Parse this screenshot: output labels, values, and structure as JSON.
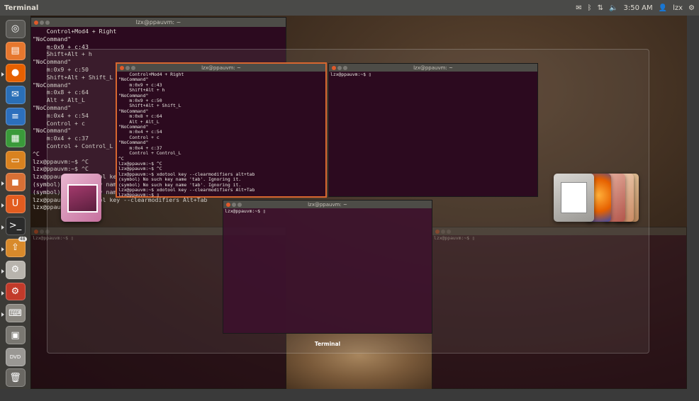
{
  "panel": {
    "app_title": "Terminal",
    "time": "3:50 AM",
    "user": "lzx",
    "icons": [
      "mail-icon",
      "bluetooth-icon",
      "network-icon",
      "volume-icon",
      "user-icon",
      "gear-icon"
    ]
  },
  "launcher": {
    "items": [
      {
        "name": "dash-home",
        "glyph": "◎",
        "color": "#5a5955"
      },
      {
        "name": "files",
        "glyph": "▤",
        "color": "#e6772e"
      },
      {
        "name": "firefox",
        "glyph": "●",
        "color": "#e66000"
      },
      {
        "name": "thunderbird",
        "glyph": "✉",
        "color": "#2a6fb7"
      },
      {
        "name": "writer",
        "glyph": "≡",
        "color": "#2c6fbd"
      },
      {
        "name": "calc",
        "glyph": "▦",
        "color": "#3a9a3a"
      },
      {
        "name": "impress",
        "glyph": "▭",
        "color": "#d9821f"
      },
      {
        "name": "software-center",
        "glyph": "◼",
        "color": "#d87035"
      },
      {
        "name": "ubuntu-one",
        "glyph": "U",
        "color": "#e25c1f"
      },
      {
        "name": "terminal",
        "glyph": ">_",
        "color": "#2b2b2b"
      },
      {
        "name": "update-manager",
        "glyph": "⇧",
        "color": "#d88a2b",
        "badge": "48"
      },
      {
        "name": "system-tools",
        "glyph": "⚙",
        "color": "#b8b4ad"
      },
      {
        "name": "system-settings",
        "glyph": "⚙",
        "color": "#c23a2a"
      },
      {
        "name": "keyboard",
        "glyph": "⌨",
        "color": "#8a8780"
      },
      {
        "name": "workspace-switcher",
        "glyph": "▣",
        "color": "#7a7872"
      },
      {
        "name": "dvd",
        "glyph": "DVD",
        "color": "#9a9894"
      },
      {
        "name": "trash",
        "glyph": "🗑",
        "color": "#6a6863"
      }
    ]
  },
  "terminals": {
    "background_title": "lzx@ppauvm: ~",
    "background_text": "    Control+Mod4 + Right\n\"NoCommand\"\n    m:0x9 + c:43\n    Shift+Alt + h\n\"NoCommand\"\n    m:0x9 + c:50\n    Shift+Alt + Shift_L\n\"NoCommand\"\n    m:0x8 + c:64\n    Alt + Alt_L\n\"NoCommand\"\n    m:0x4 + c:54\n    Control + c\n\"NoCommand\"\n    m:0x4 + c:37\n    Control + Control_L\n^C\nlzx@ppauvm:~$ ^C\nlzx@ppauvm:~$ ^C\nlzx@ppauvm:~$ xdotool key --clearmodifiers alt+tab\n(symbol) No such key name 'tab'. Ignoring it.\n(symbol) No such key name 'tab'. Ignoring it.\nlzx@ppauvm:~$ xdotool key --clearmodifiers Alt+Tab\nlzx@ppauvm:~$ ",
    "active_title": "lzx@ppauvm: ~",
    "active_text": "    Control+Mod4 + Right\n\"NoCommand\"\n    m:0x9 + c:43\n    Shift+Alt + h\n\"NoCommand\"\n    m:0x9 + c:50\n    Shift+Alt + Shift_L\n\"NoCommand\"\n    m:0x8 + c:64\n    Alt + Alt_L\n\"NoCommand\"\n    m:0x4 + c:54\n    Control + c\n\"NoCommand\"\n    m:0x4 + c:37\n    Control + Control_L\n^C\nlzx@ppauvm:~$ ^C\nlzx@ppauvm:~$ ^C\nlzx@ppauvm:~$ xdotool key --clearmodifiers alt+tab\n(symbol) No such key name 'tab'. Ignoring it.\n(symbol) No such key name 'tab'. Ignoring it.\nlzx@ppauvm:~$ xdotool key --clearmodifiers Alt+Tab\nlzx@ppauvm:~$ ▯",
    "right_title": "lzx@ppauvm: ~",
    "right_text": "lzx@ppauvm:~$ ▯",
    "bottom_title": "lzx@ppauvm: ~",
    "bottom_text": "lzx@ppauvm:~$ ▯",
    "lower_left_text": "lzx@ppauvm:~$ ▯",
    "lower_right_text": "lzx@ppauvm:~$ ▯"
  },
  "switcher": {
    "label": "Terminal"
  }
}
